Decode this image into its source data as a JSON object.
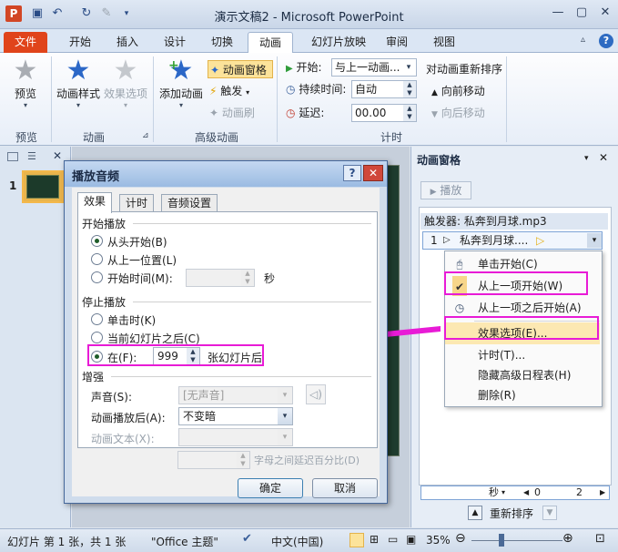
{
  "window": {
    "title": "演示文稿2 - Microsoft PowerPoint",
    "app_icon": "P",
    "quick_access": [
      "save-icon",
      "undo-icon",
      "redo-icon",
      "brush-icon"
    ],
    "help": "?"
  },
  "tabs": [
    "文件",
    "开始",
    "插入",
    "设计",
    "切换",
    "动画",
    "幻灯片放映",
    "审阅",
    "视图"
  ],
  "active_tab": "动画",
  "ribbon": {
    "preview": {
      "button": "预览",
      "group": "预览"
    },
    "animation": {
      "style_button": "动画样式",
      "effect_button": "效果选项",
      "group": "动画"
    },
    "advanced": {
      "add_button": "添加动画",
      "pane_button": "动画窗格",
      "trigger_button": "触发",
      "painter_button": "动画刷",
      "group": "高级动画"
    },
    "timing": {
      "start_label": "开始:",
      "start_value": "与上一动画...",
      "duration_label": "持续时间:",
      "duration_value": "自动",
      "delay_label": "延迟:",
      "delay_value": "00.00",
      "reorder_label": "对动画重新排序",
      "move_earlier": "向前移动",
      "move_later": "向后移动",
      "group": "计时"
    }
  },
  "slides_panel": {
    "slide_number": "1"
  },
  "animation_pane": {
    "title": "动画窗格",
    "play_button": "播放",
    "trigger_label": "触发器: 私奔到月球.mp3",
    "item_number": "1",
    "item_label": "私奔到月球....",
    "menu": [
      {
        "icon": "mouse-icon",
        "label": "单击开始(C)"
      },
      {
        "icon": "check-icon",
        "label": "从上一项开始(W)"
      },
      {
        "icon": "clock-icon",
        "label": "从上一项之后开始(A)"
      },
      {
        "icon": "",
        "label": "效果选项(E)..."
      },
      {
        "icon": "",
        "label": "计时(T)..."
      },
      {
        "icon": "",
        "label": "隐藏高级日程表(H)"
      },
      {
        "icon": "",
        "label": "删除(R)"
      }
    ],
    "timeline_unit": "秒",
    "timeline_start": "0",
    "timeline_end": "2",
    "reorder_label": "重新排序"
  },
  "dialog": {
    "title": "播放音频",
    "tabs": [
      "效果",
      "计时",
      "音频设置"
    ],
    "start_section": "开始播放",
    "start_options": [
      "从头开始(B)",
      "从上一位置(L)",
      "开始时间(M):"
    ],
    "start_time_unit": "秒",
    "stop_section": "停止播放",
    "stop_options": [
      "单击时(K)",
      "当前幻灯片之后(C)",
      "在(F):"
    ],
    "stop_after_value": "999",
    "stop_after_unit": "张幻灯片后",
    "enhance_section": "增强",
    "sound_label": "声音(S):",
    "sound_value": "[无声音]",
    "after_anim_label": "动画播放后(A):",
    "after_anim_value": "不变暗",
    "anim_text_label": "动画文本(X):",
    "delay_between": "字母之间延迟百分比(D)",
    "ok": "确定",
    "cancel": "取消"
  },
  "status": {
    "slide_info": "幻灯片 第 1 张，共 1 张",
    "theme": "\"Office 主题\"",
    "language": "中文(中国)",
    "zoom": "35%"
  },
  "colors": {
    "file_tab": "#e0441b",
    "highlight": "#e81bd6",
    "dialog_title": "#9bbbe2"
  }
}
